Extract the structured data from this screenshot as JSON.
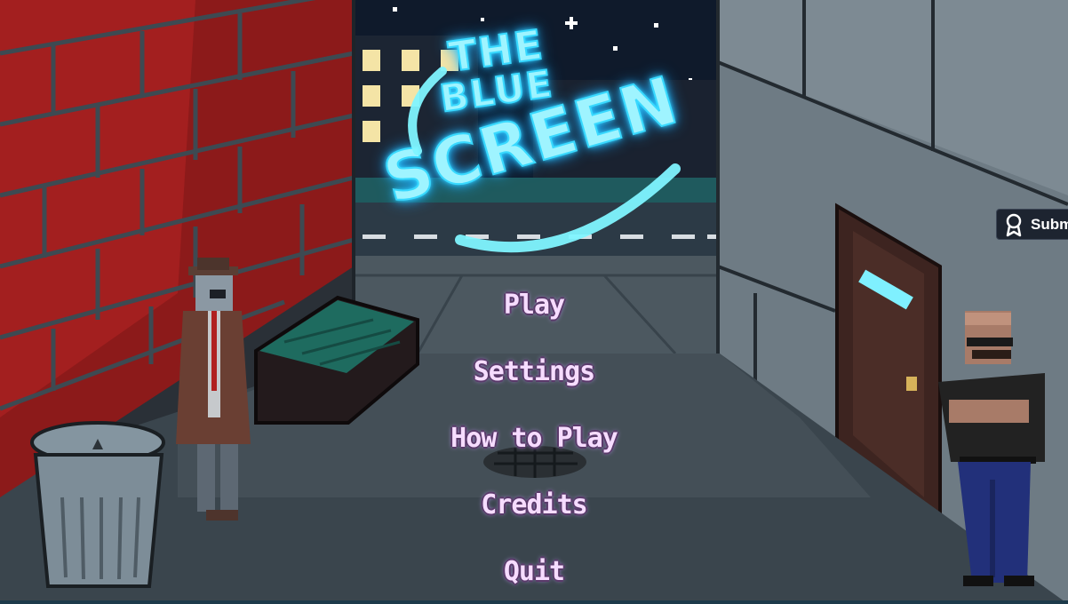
{
  "game": {
    "title_line1": "THE",
    "title_line2": "BLUE",
    "title_line3": "SCREEN"
  },
  "menu": {
    "items": [
      {
        "label": "Play"
      },
      {
        "label": "Settings"
      },
      {
        "label": "How to Play"
      },
      {
        "label": "Credits"
      },
      {
        "label": "Quit"
      }
    ]
  },
  "overlay": {
    "submit_label": "Subm",
    "submit_icon": "award-ribbon-icon"
  },
  "colors": {
    "neon": "#38d9ff",
    "menu_text": "#f6dcff",
    "brick": "#8c1a1a"
  }
}
